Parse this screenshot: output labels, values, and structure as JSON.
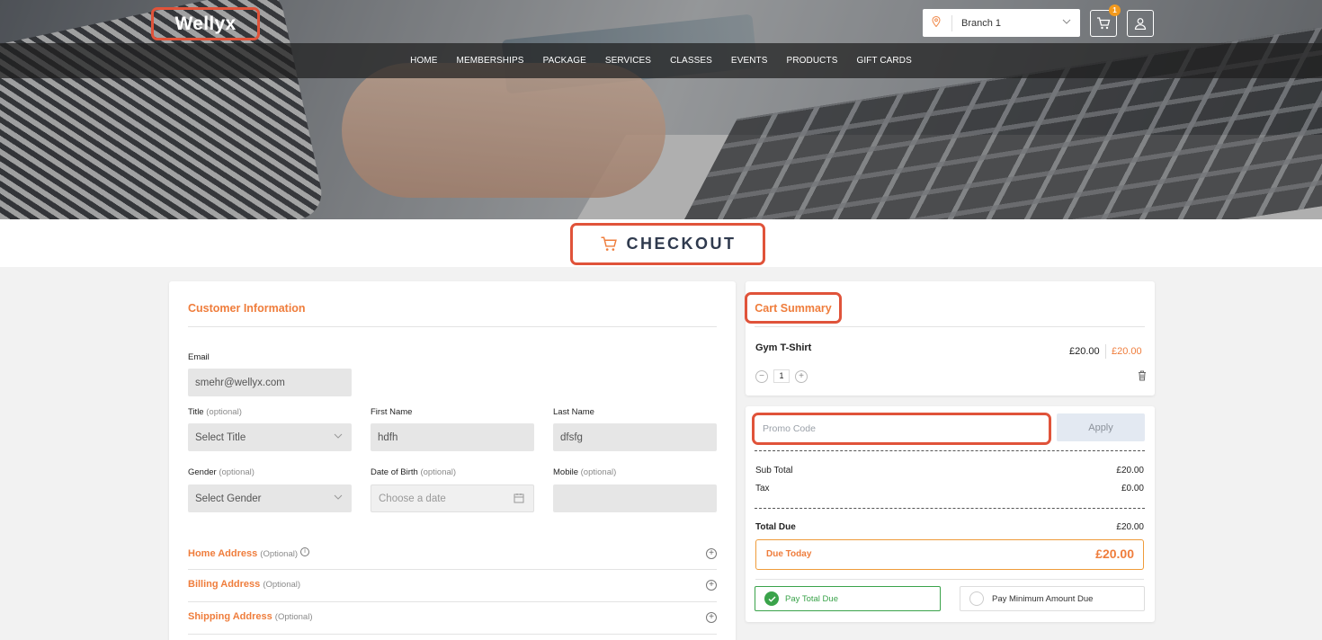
{
  "header": {
    "logo": "Wellyx",
    "branch": "Branch 1",
    "cart_count": "1",
    "nav": [
      "HOME",
      "MEMBERSHIPS",
      "PACKAGE",
      "SERVICES",
      "CLASSES",
      "EVENTS",
      "PRODUCTS",
      "GIFT CARDS"
    ]
  },
  "checkout": {
    "title": "CHECKOUT"
  },
  "customer": {
    "section_title": "Customer Information",
    "email_label": "Email",
    "email_value": "smehr@wellyx.com",
    "title_label": "Title",
    "title_optional": "(optional)",
    "title_value": "Select Title",
    "first_name_label": "First Name",
    "first_name_value": "hdfh",
    "last_name_label": "Last Name",
    "last_name_value": "dfsfg",
    "gender_label": "Gender",
    "gender_optional": "(optional)",
    "gender_value": "Select Gender",
    "dob_label": "Date of Birth",
    "dob_optional": "(optional)",
    "dob_placeholder": "Choose a date",
    "mobile_label": "Mobile",
    "mobile_optional": "(optional)",
    "mobile_value": "",
    "home_address": "Home Address",
    "billing_address": "Billing Address",
    "shipping_address": "Shipping Address",
    "optional_cap": "(Optional)"
  },
  "cart": {
    "title": "Cart Summary",
    "item_name": "Gym T-Shirt",
    "item_price": "£20.00",
    "item_total": "£20.00",
    "qty": "1"
  },
  "summary": {
    "promo_placeholder": "Promo Code",
    "apply": "Apply",
    "subtotal_label": "Sub Total",
    "subtotal": "£20.00",
    "tax_label": "Tax",
    "tax": "£0.00",
    "total_due_label": "Total Due",
    "total_due": "£20.00",
    "due_today_label": "Due Today",
    "due_today": "£20.00",
    "pay_total": "Pay Total Due",
    "pay_min": "Pay Minimum Amount Due"
  },
  "colors": {
    "accent": "#ef7d3c",
    "highlight": "#e0533a",
    "success": "#3aa34a",
    "heading": "#2f3a4e"
  }
}
